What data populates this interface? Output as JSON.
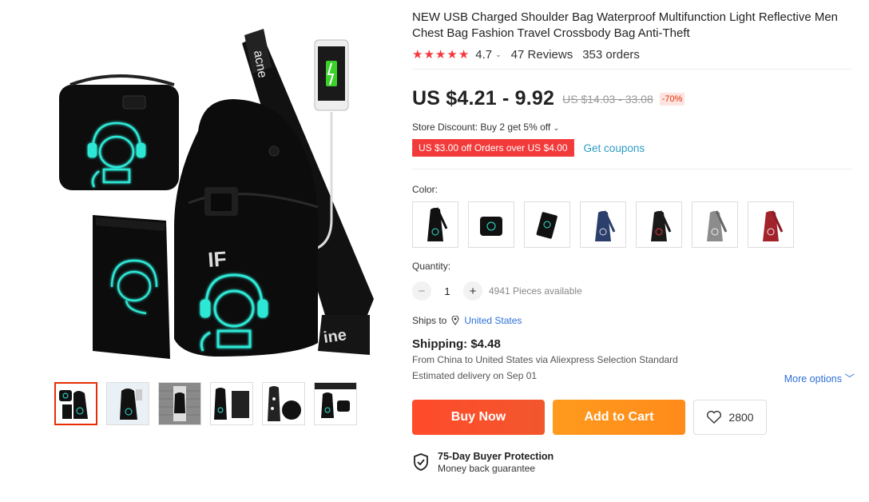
{
  "product": {
    "title": "NEW USB Charged Shoulder Bag Waterproof Multifunction Light Reflective Men Chest Bag Fashion Travel Crossbody Bag Anti-Theft",
    "rating": "4.7",
    "reviews": "47 Reviews",
    "orders": "353 orders",
    "price": "US $4.21 - 9.92",
    "original_price": "US $14.03 - 33.08",
    "discount_percent": "-70%"
  },
  "promotions": {
    "store_discount": "Store Discount: Buy 2 get 5% off",
    "coupon_text": "US $3.00 off Orders over US $4.00",
    "get_coupons": "Get coupons"
  },
  "variants": {
    "color_label": "Color:",
    "colors": [
      "black-set",
      "black-messenger",
      "black-wallet",
      "blue",
      "black",
      "gray",
      "red"
    ]
  },
  "quantity": {
    "label": "Quantity:",
    "value": "1",
    "minus": "−",
    "plus": "+",
    "available": "4941 Pieces available"
  },
  "shipping": {
    "ships_to_label": "Ships to",
    "country": "United States",
    "cost": "Shipping: $4.48",
    "route": "From China to United States via Aliexpress Selection Standard",
    "delivery": "Estimated delivery on Sep 01",
    "more_options": "More options"
  },
  "actions": {
    "buy_now": "Buy Now",
    "add_to_cart": "Add to Cart",
    "wishlist_count": "2800"
  },
  "protection": {
    "title": "75-Day Buyer Protection",
    "subtitle": "Money back guarantee"
  },
  "colors": {
    "accent_red": "#e62e04",
    "star_red": "#f5363b",
    "link_blue": "#2e6fd8",
    "glow_cyan": "#2ee8d6"
  }
}
